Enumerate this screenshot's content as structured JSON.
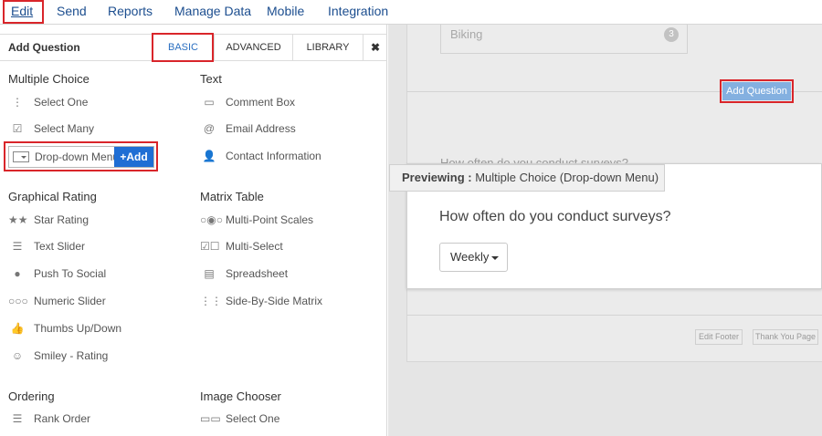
{
  "nav": {
    "items": [
      "Edit",
      "Send",
      "Reports",
      "Manage Data",
      "Mobile",
      "Integration"
    ]
  },
  "panel": {
    "title": "Add Question",
    "tabs": [
      "BASIC",
      "ADVANCED",
      "LIBRARY"
    ],
    "close": "✖"
  },
  "sections": {
    "multiple_choice": {
      "title": "Multiple Choice",
      "items": [
        "Select One",
        "Select Many",
        "Drop-down Menu"
      ],
      "add_label": "+Add"
    },
    "text": {
      "title": "Text",
      "items": [
        "Comment Box",
        "Email Address",
        "Contact Information"
      ]
    },
    "graphical_rating": {
      "title": "Graphical Rating",
      "items": [
        "Star Rating",
        "Text Slider",
        "Push To Social",
        "Numeric Slider",
        "Thumbs Up/Down",
        "Smiley - Rating"
      ]
    },
    "matrix_table": {
      "title": "Matrix Table",
      "items": [
        "Multi-Point Scales",
        "Multi-Select",
        "Spreadsheet",
        "Side-By-Side Matrix"
      ]
    },
    "ordering": {
      "title": "Ordering",
      "items": [
        "Rank Order"
      ]
    },
    "image_chooser": {
      "title": "Image Chooser",
      "items": [
        "Select One"
      ]
    }
  },
  "canvas": {
    "answer_option": "Biking",
    "answer_number": "3",
    "add_question": "Add Question",
    "hidden_question": "How often do you conduct surveys?",
    "preview_prefix": "Previewing :",
    "preview_type": "Multiple Choice (Drop-down Menu)",
    "question": "How often do you conduct surveys?",
    "dropdown_value": "Weekly",
    "edit_footer": "Edit Footer",
    "thank_you_page": "Thank You Page"
  },
  "colors": {
    "accent_blue": "#1f6ed4",
    "nav_link": "#1c4e8f",
    "highlight_red": "#d9252a",
    "add_question_bg": "#84b0e0"
  }
}
